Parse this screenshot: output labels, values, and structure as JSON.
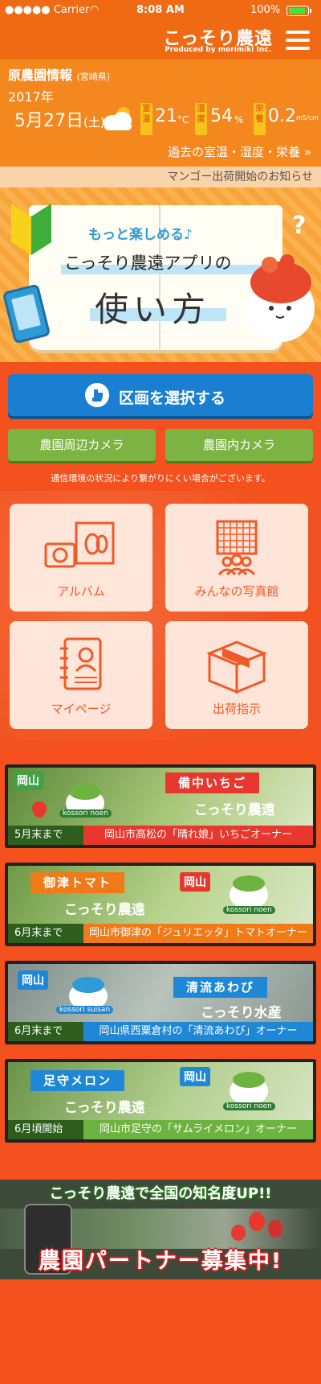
{
  "status_bar": {
    "signal": "●●●●● Carrier",
    "time": "8:08 AM",
    "battery": "100%"
  },
  "header": {
    "logo": "こっそり農遠",
    "logo_sub": "Produced by morimiki Inc.",
    "menu_icon": "hamburger-icon"
  },
  "farm_info": {
    "name": "原農園情報",
    "pref": "(宮崎県)",
    "year": "2017年",
    "date": "5月27日",
    "weekday": "(土)",
    "weather_icon": "partly-cloudy-icon",
    "temp_tag": "室温",
    "temp_value": "21",
    "temp_unit": "°C",
    "humidity_tag": "湿度",
    "humidity_value": "54",
    "humidity_unit": "%",
    "nutrient_tag": "栄養",
    "nutrient_value": "0.2",
    "nutrient_unit": "mS/cm",
    "past_link": "過去の室温・湿度・栄養 »"
  },
  "notice": "マンゴー出荷開始のお知らせ",
  "guide_banner": {
    "line1": "もっと楽しめる♪",
    "line2": "こっそり農遠アプリの",
    "line3": "使い方",
    "question": "?"
  },
  "select_button": {
    "label": "区画を選択する",
    "icon": "pointing-hand-icon"
  },
  "camera_buttons": {
    "outer": "農園周辺カメラ",
    "inner": "農園内カメラ"
  },
  "camera_note": "通信環境の状況により繋がりにくい場合がございます。",
  "tiles": [
    {
      "label": "アルバム",
      "icon": "album-icon"
    },
    {
      "label": "みんなの写真館",
      "icon": "gallery-icon"
    },
    {
      "label": "マイページ",
      "icon": "mypage-icon"
    },
    {
      "label": "出荷指示",
      "icon": "shipping-box-icon"
    }
  ],
  "owners": [
    {
      "pref": "岡山",
      "ribbon": "備中いちご",
      "brand": "こっそり農遠",
      "mascot_label": "kossori noen",
      "deadline": "5月末まで",
      "desc": "岡山市高松の「晴れ娘」いちごオーナー",
      "bar_color": "#e8382e",
      "ribbon_color": "#e8382e"
    },
    {
      "pref": "岡山",
      "ribbon": "御津トマト",
      "brand": "こっそり農遠",
      "mascot_label": "kossori noen",
      "deadline": "6月末まで",
      "desc": "岡山市御津の「ジュリエッタ」トマトオーナー",
      "bar_color": "#f07a18",
      "ribbon_color": "#f07a18"
    },
    {
      "pref": "岡山",
      "ribbon": "清流あわび",
      "brand": "こっそり水産",
      "mascot_label": "kossori suisan",
      "deadline": "6月末まで",
      "desc": "岡山県西粟倉村の「清流あわび」オーナー",
      "bar_color": "#1e88d6",
      "ribbon_color": "#1e88d6"
    },
    {
      "pref": "岡山",
      "ribbon": "足守メロン",
      "brand": "こっそり農遠",
      "mascot_label": "kossori noen",
      "deadline": "6月頃開始",
      "desc": "岡山市足守の「サムライメロン」オーナー",
      "bar_color": "#6db33f",
      "ribbon_color": "#1e88d6"
    }
  ],
  "partner_banner": {
    "top": "こっそり農遠で全国の知名度UP!!",
    "bottom": "農園パートナー募集中!"
  }
}
